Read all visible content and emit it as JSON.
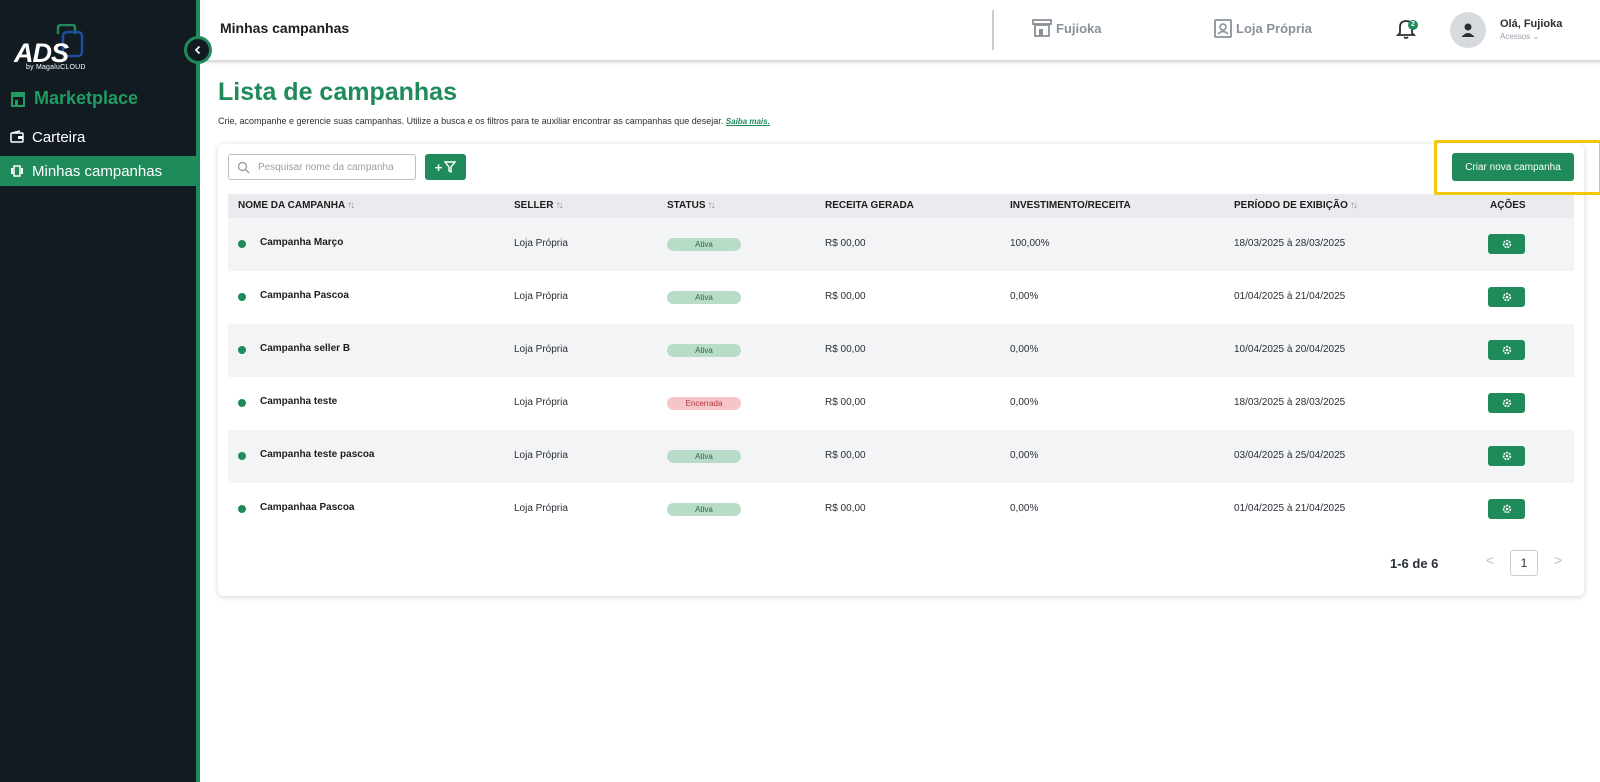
{
  "brand": {
    "logo_text": "ADS",
    "logo_sub": "by MagaluCLOUD"
  },
  "sidebar": {
    "section_label": "Marketplace",
    "items": [
      {
        "label": "Carteira",
        "icon": "wallet-icon",
        "active": false
      },
      {
        "label": "Minhas campanhas",
        "icon": "campaigns-icon",
        "active": true
      }
    ]
  },
  "header": {
    "title": "Minhas campanhas",
    "stores": [
      {
        "label": "Fujioka",
        "icon": "store-icon"
      },
      {
        "label": "Loja Própria",
        "icon": "badge-icon"
      }
    ],
    "notifications_count": "2",
    "user_greeting": "Olá, Fujioka",
    "user_access": "Acessos"
  },
  "main": {
    "title": "Lista de campanhas",
    "description": "Crie, acompanhe e gerencie suas campanhas. Utilize a busca e os filtros para te auxiliar encontrar as campanhas que desejar.",
    "learn_more": "Saiba mais.",
    "search_placeholder": "Pesquisar nome da campanha",
    "filter_label": "+",
    "create_button": "Criar nova campanha"
  },
  "table": {
    "columns": [
      "NOME DA CAMPANHA",
      "SELLER",
      "STATUS",
      "RECEITA GERADA",
      "INVESTIMENTO/RECEITA",
      "PERÍODO DE EXIBIÇÃO",
      "AÇÕES"
    ],
    "rows": [
      {
        "name": "Campanha Março",
        "seller": "Loja Própria",
        "status": "Ativa",
        "revenue": "R$ 00,00",
        "ratio": "100,00%",
        "period": "18/03/2025 à 28/03/2025"
      },
      {
        "name": "Campanha Pascoa",
        "seller": "Loja Própria",
        "status": "Ativa",
        "revenue": "R$ 00,00",
        "ratio": "0,00%",
        "period": "01/04/2025 à 21/04/2025"
      },
      {
        "name": "Campanha seller B",
        "seller": "Loja Própria",
        "status": "Ativa",
        "revenue": "R$ 00,00",
        "ratio": "0,00%",
        "period": "10/04/2025 à 20/04/2025"
      },
      {
        "name": "Campanha teste",
        "seller": "Loja Própria",
        "status": "Encerrada",
        "revenue": "R$ 00,00",
        "ratio": "0,00%",
        "period": "18/03/2025 à 28/03/2025"
      },
      {
        "name": "Campanha teste pascoa",
        "seller": "Loja Própria",
        "status": "Ativa",
        "revenue": "R$ 00,00",
        "ratio": "0,00%",
        "period": "03/04/2025 à 25/04/2025"
      },
      {
        "name": "Campanhaa Pascoa",
        "seller": "Loja Própria",
        "status": "Ativa",
        "revenue": "R$ 00,00",
        "ratio": "0,00%",
        "period": "01/04/2025 à 21/04/2025"
      }
    ]
  },
  "pagination": {
    "info": "1-6 de 6",
    "current_page": "1"
  },
  "colors": {
    "primary": "#1f8a5a",
    "sidebar_bg": "#121a22",
    "highlight": "#f2c80f",
    "active_pill": "#b9dcc9",
    "closed_pill": "#f6c5c7"
  }
}
